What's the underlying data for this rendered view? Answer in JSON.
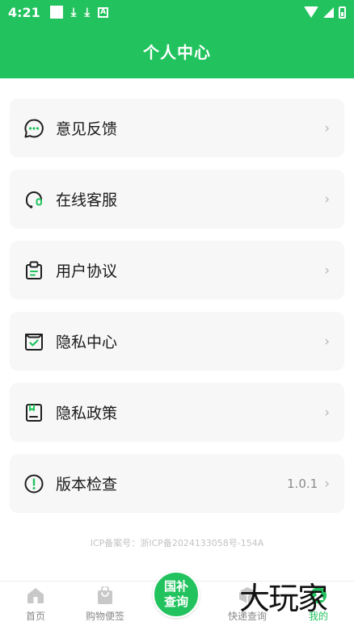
{
  "status_bar": {
    "time": "4:21",
    "a_badge": "A"
  },
  "header": {
    "title": "个人中心"
  },
  "menu": [
    {
      "label": "意见反馈",
      "icon": "chat-bubble-icon",
      "value": ""
    },
    {
      "label": "在线客服",
      "icon": "headset-icon",
      "value": ""
    },
    {
      "label": "用户协议",
      "icon": "clipboard-icon",
      "value": ""
    },
    {
      "label": "隐私中心",
      "icon": "check-box-icon",
      "value": ""
    },
    {
      "label": "隐私政策",
      "icon": "document-icon",
      "value": ""
    },
    {
      "label": "版本检查",
      "icon": "alert-circle-icon",
      "value": "1.0.1"
    }
  ],
  "footer": {
    "icp": "ICP备案号：浙ICP备2024133058号-154A"
  },
  "tabbar": {
    "home": "首页",
    "bag": "购物便签",
    "center": "国补查询",
    "express": "快递查询",
    "mine": "我的"
  },
  "watermark": "大玩家",
  "colors": {
    "brand": "#22c35e",
    "card_bg": "#f7f7f7",
    "text": "#1a1a1a",
    "muted": "#8a8a8a"
  }
}
